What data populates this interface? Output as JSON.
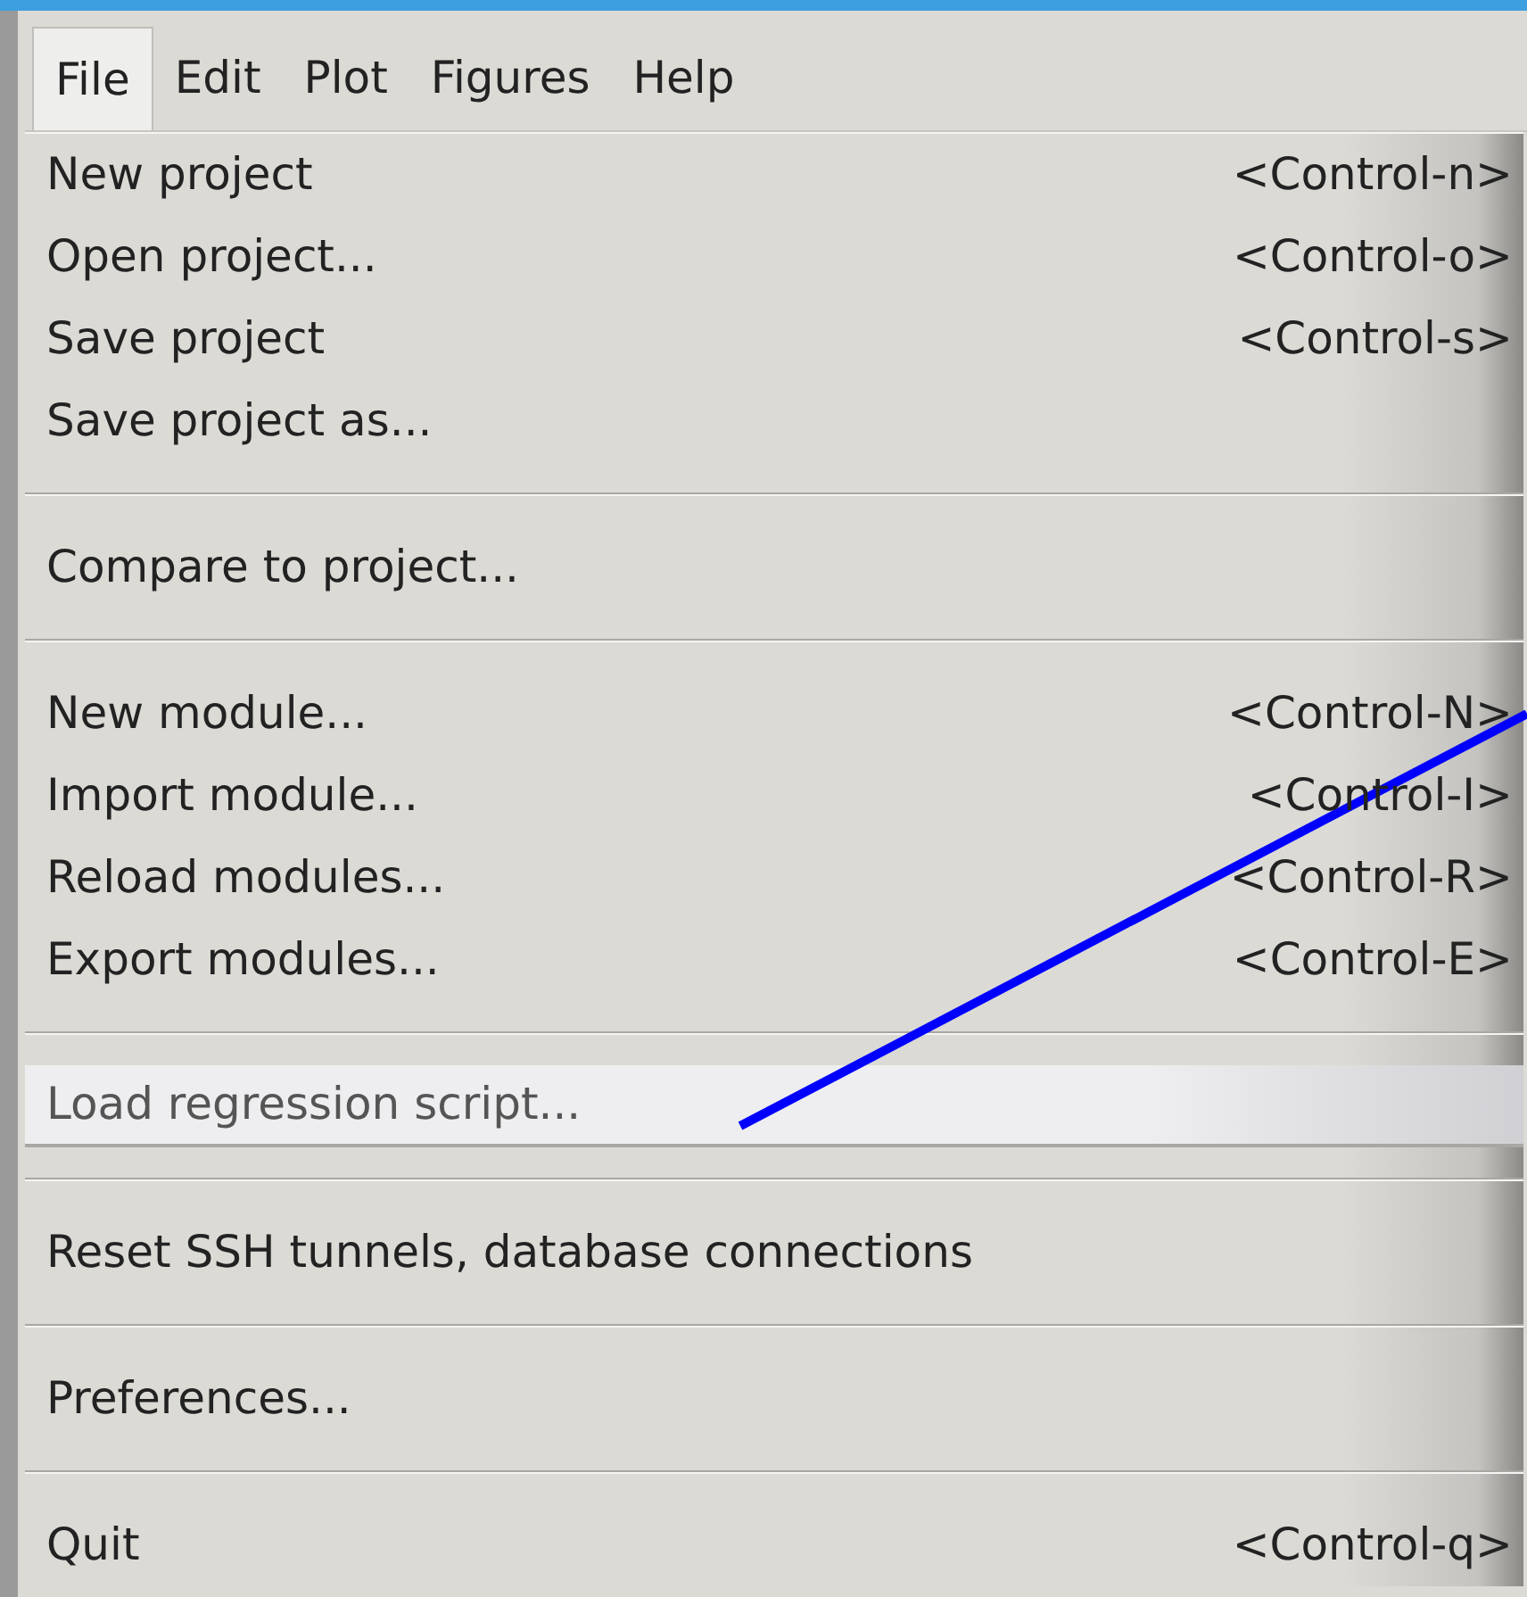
{
  "menubar": [
    {
      "label": "File",
      "selected": true
    },
    {
      "label": "Edit",
      "selected": false
    },
    {
      "label": "Plot",
      "selected": false
    },
    {
      "label": "Figures",
      "selected": false
    },
    {
      "label": "Help",
      "selected": false
    }
  ],
  "menu": {
    "items": [
      {
        "kind": "item",
        "label": "New project",
        "shortcut": "<Control-n>",
        "selected": false
      },
      {
        "kind": "item",
        "label": "Open project...",
        "shortcut": "<Control-o>",
        "selected": false
      },
      {
        "kind": "item",
        "label": "Save project",
        "shortcut": "<Control-s>",
        "selected": false
      },
      {
        "kind": "item",
        "label": "Save project as...",
        "selected": false
      },
      {
        "kind": "separator"
      },
      {
        "kind": "item",
        "label": "Compare to project...",
        "selected": false
      },
      {
        "kind": "separator"
      },
      {
        "kind": "item",
        "label": "New module...",
        "shortcut": "<Control-N>",
        "selected": false
      },
      {
        "kind": "item",
        "label": "Import module...",
        "shortcut": "<Control-I>",
        "selected": false
      },
      {
        "kind": "item",
        "label": "Reload modules...",
        "shortcut": "<Control-R>",
        "selected": false
      },
      {
        "kind": "item",
        "label": "Export modules...",
        "shortcut": "<Control-E>",
        "selected": false
      },
      {
        "kind": "separator"
      },
      {
        "kind": "item",
        "label": "Load regression script...",
        "selected": true
      },
      {
        "kind": "separator"
      },
      {
        "kind": "item",
        "label": "Reset SSH tunnels, database connections",
        "selected": false
      },
      {
        "kind": "separator"
      },
      {
        "kind": "item",
        "label": "Preferences...",
        "selected": false
      },
      {
        "kind": "separator"
      },
      {
        "kind": "item",
        "label": "Quit",
        "shortcut": "<Control-q>",
        "selected": false
      }
    ]
  }
}
